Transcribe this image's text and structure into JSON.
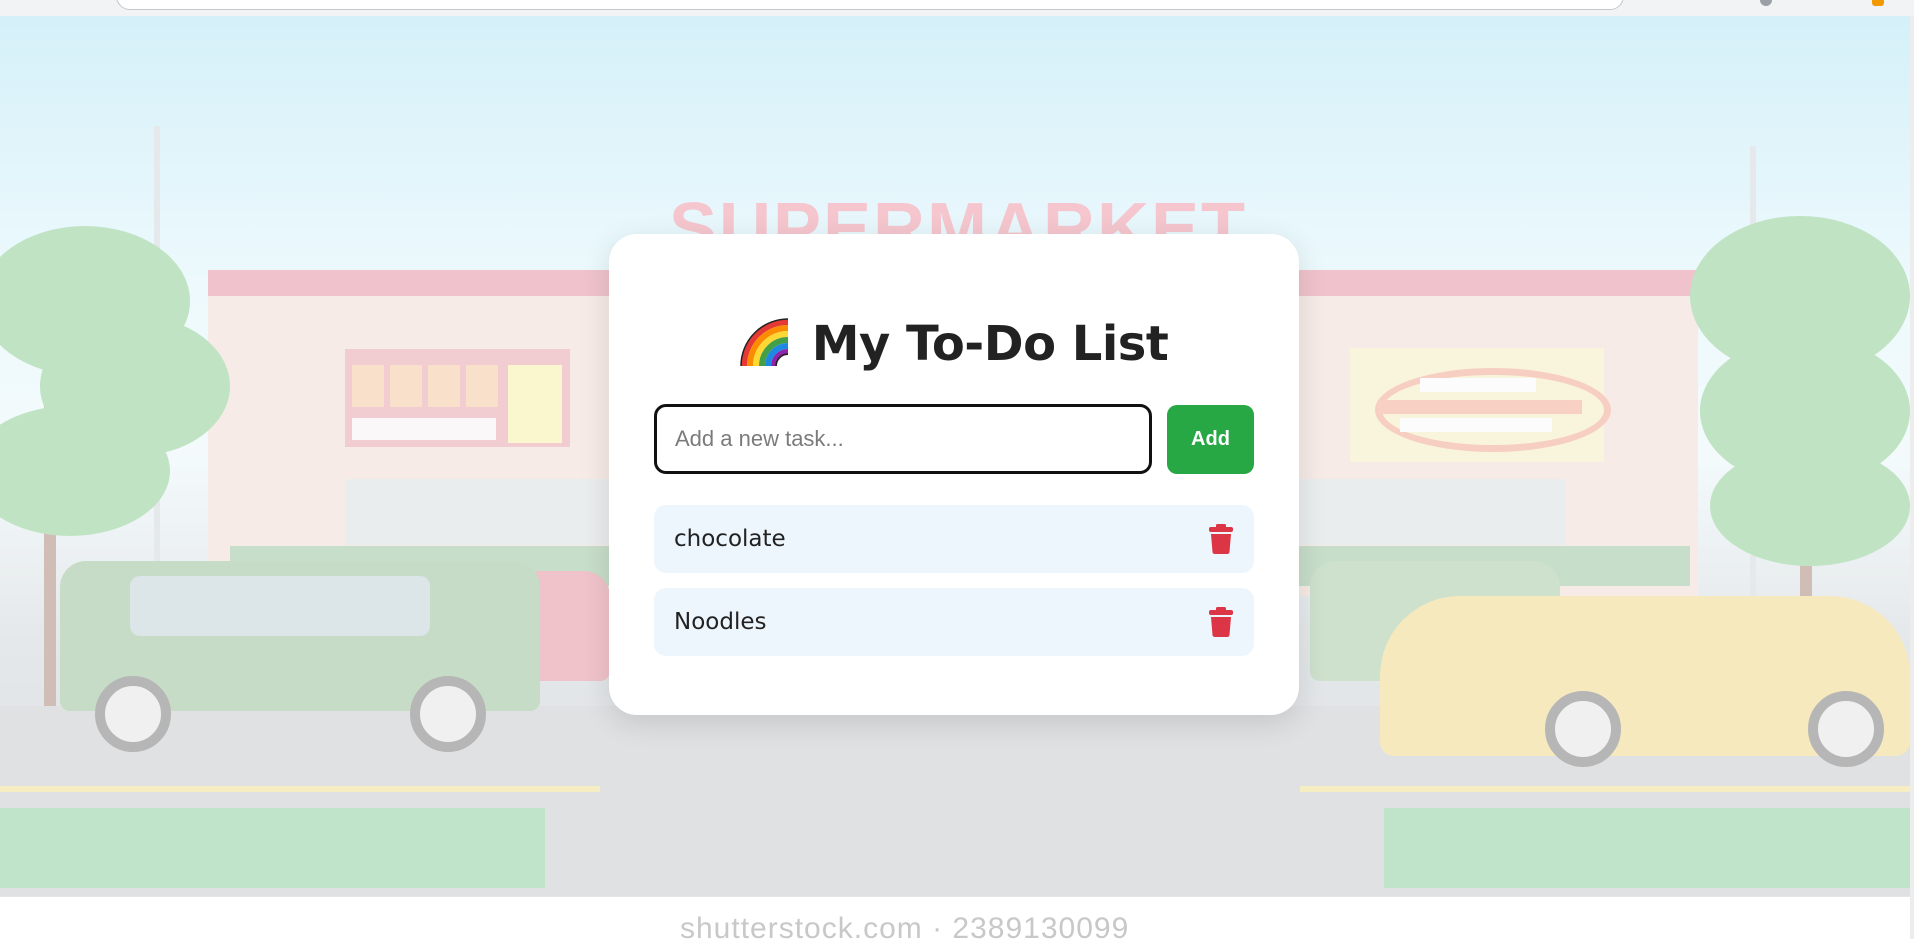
{
  "background": {
    "store_sign_text": "SUPERMARKET",
    "watermark_text": "shutterstock.com · 2389130099"
  },
  "todo": {
    "title_icon": "rainbow-icon",
    "title": "My To-Do List",
    "input": {
      "value": "",
      "placeholder": "Add a new task..."
    },
    "add_label": "Add",
    "tasks": [
      {
        "text": "chocolate",
        "delete_icon": "trash-icon"
      },
      {
        "text": "Noodles",
        "delete_icon": "trash-icon"
      }
    ]
  },
  "colors": {
    "accent_green": "#28a745",
    "delete_red": "#dc3545",
    "task_bg": "#eef6fd",
    "title_text": "#222222"
  }
}
